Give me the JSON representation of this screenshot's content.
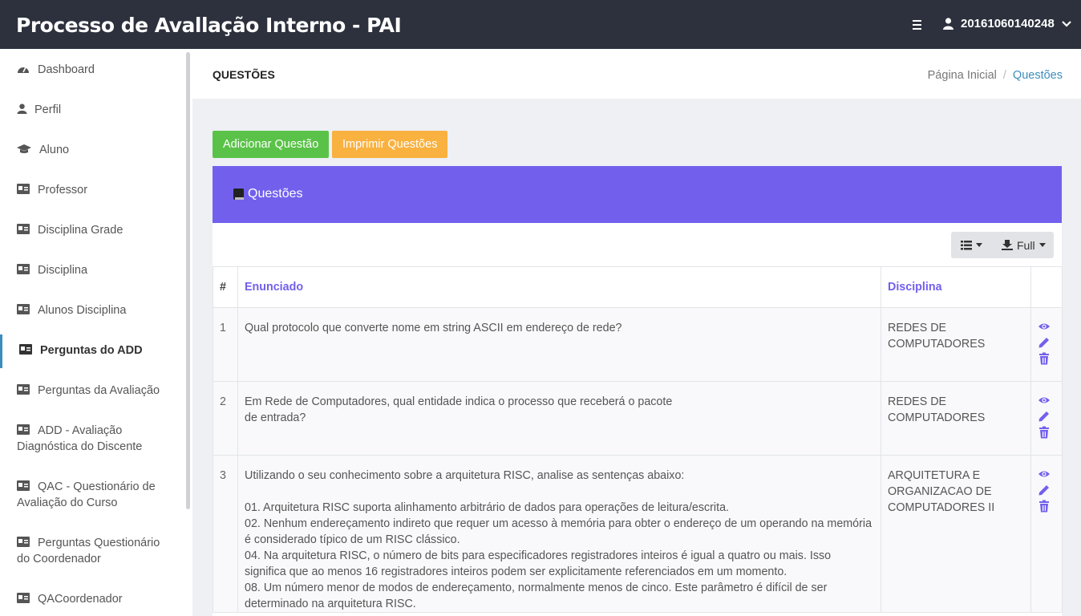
{
  "app": {
    "title": "Processo de Avallação Interno - PAI"
  },
  "user": {
    "id": "20161060140248"
  },
  "sidebar": {
    "items": [
      {
        "label": "Dashboard",
        "icon": "tachometer-icon"
      },
      {
        "label": "Perfil",
        "icon": "user-icon"
      },
      {
        "label": "Aluno",
        "icon": "graduation-cap-icon"
      },
      {
        "label": "Professor",
        "icon": "id-card-icon"
      },
      {
        "label": "Disciplina Grade",
        "icon": "id-card-icon"
      },
      {
        "label": "Disciplina",
        "icon": "id-card-icon"
      },
      {
        "label": "Alunos Disciplina",
        "icon": "id-card-icon"
      },
      {
        "label": "Perguntas do ADD",
        "icon": "id-card-icon",
        "active": true
      },
      {
        "label": "Perguntas da Avaliação",
        "icon": "id-card-icon"
      },
      {
        "label": "ADD - Avaliação Diagnóstica do Discente",
        "icon": "id-card-icon"
      },
      {
        "label": "QAC - Questionário de Avaliação do Curso",
        "icon": "id-card-icon"
      },
      {
        "label": "Perguntas Questionário do Coordenador",
        "icon": "id-card-icon"
      },
      {
        "label": "QACoordenador",
        "icon": "id-card-icon"
      }
    ]
  },
  "header": {
    "page_title": "QUESTÕES",
    "breadcrumb": {
      "home": "Página Inicial",
      "separator": "/",
      "current": "Questões"
    }
  },
  "actions": {
    "add_label": "Adicionar Questão",
    "print_label": "Imprimir Questões"
  },
  "panel": {
    "title": "Questões",
    "toolbar": {
      "columns_icon": "list-icon",
      "export_label": "Full"
    }
  },
  "table": {
    "headers": {
      "num": "#",
      "statement": "Enunciado",
      "discipline": "Disciplina"
    },
    "rows": [
      {
        "num": "1",
        "statement": "Qual protocolo que converte nome em string ASCII em endereço de rede?",
        "discipline": "REDES DE COMPUTADORES"
      },
      {
        "num": "2",
        "statement": "Em Rede de Computadores, qual entidade indica o processo que receberá o pacote\nde entrada?",
        "discipline": "REDES DE COMPUTADORES"
      },
      {
        "num": "3",
        "statement": "Utilizando o seu conhecimento sobre a arquitetura RISC, analise as sentenças abaixo:\n\n01. Arquitetura RISC suporta alinhamento arbitrário de dados para operações de leitura/escrita.\n02. Nenhum endereçamento indireto que requer um acesso à memória para obter o endereço de um operando na memória é considerado típico de um RISC clássico.\n04. Na arquitetura RISC, o número de bits para especificadores registradores inteiros é igual a quatro ou mais. Isso significa que ao menos 16 registradores inteiros podem ser explicitamente referenciados em um momento.\n08. Um número menor de modos de endereçamento, normalmente menos de cinco. Este parâmetro é difícil de ser determinado na arquitetura RISC.",
        "discipline": "ARQUITETURA E ORGANIZACAO DE COMPUTADORES II"
      }
    ],
    "row_actions": [
      "eye-icon",
      "pencil-icon",
      "trash-icon"
    ]
  },
  "colors": {
    "topbar": "#2d313d",
    "accent": "#7260ed",
    "add": "#5ac248",
    "print": "#f9b13f",
    "link": "#3c8dbc"
  }
}
